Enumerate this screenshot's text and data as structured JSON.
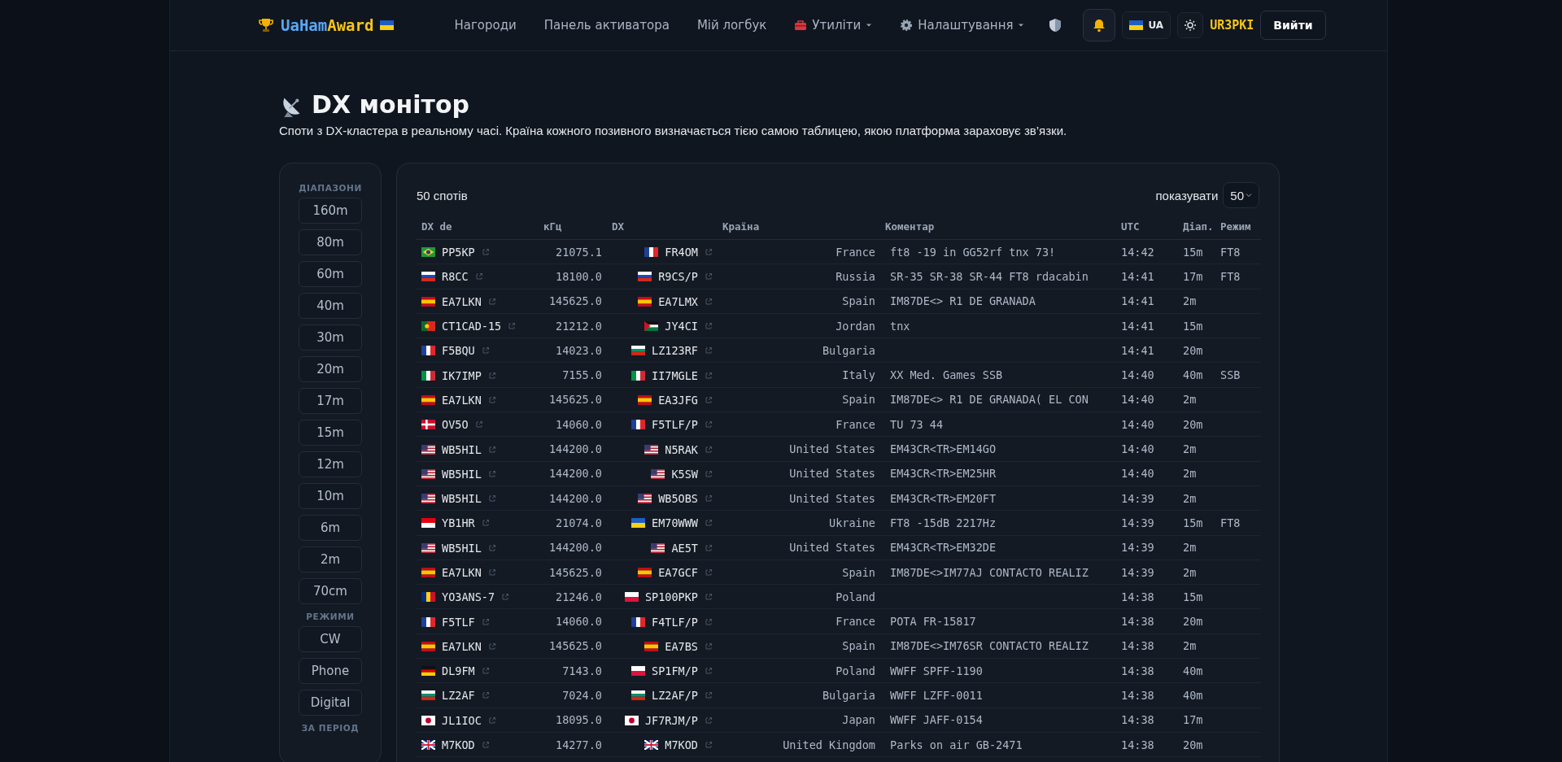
{
  "header": {
    "brand": {
      "first": "UaHam",
      "second": "Award"
    },
    "nav": [
      {
        "label": "Нагороди",
        "kind": "link"
      },
      {
        "label": "Панель активатора",
        "kind": "link"
      },
      {
        "label": "Мій логбук",
        "kind": "link"
      },
      {
        "label": "Утиліти",
        "kind": "tools"
      },
      {
        "label": "Налаштування",
        "kind": "settings"
      }
    ],
    "language": "UA",
    "user": "UR3PKI",
    "logout": "Вийти"
  },
  "page": {
    "title": "DX монітор",
    "subtitle": "Споти з DX-кластера в реальному часі. Країна кожного позивного визначається тією самою таблицею, якою платформа зараховує зв’язки."
  },
  "filters": [
    {
      "heading": "ДІАПАЗОНИ",
      "items": [
        {
          "label": "160m",
          "selected": false
        },
        {
          "label": "80m",
          "selected": false
        },
        {
          "label": "60m",
          "selected": false
        },
        {
          "label": "40m",
          "selected": false
        },
        {
          "label": "30m",
          "selected": false
        },
        {
          "label": "20m",
          "selected": false
        },
        {
          "label": "17m",
          "selected": false
        },
        {
          "label": "15m",
          "selected": false
        },
        {
          "label": "12m",
          "selected": false
        },
        {
          "label": "10m",
          "selected": false
        },
        {
          "label": "6m",
          "selected": false
        },
        {
          "label": "2m",
          "selected": false
        },
        {
          "label": "70cm",
          "selected": false
        }
      ]
    },
    {
      "heading": "РЕЖИМИ",
      "items": [
        {
          "label": "CW",
          "selected": false
        },
        {
          "label": "Phone",
          "selected": false
        },
        {
          "label": "Digital",
          "selected": false
        }
      ]
    },
    {
      "heading": "ЗА ПЕРІОД"
    }
  ],
  "table": {
    "count": "50 спотів",
    "show_label": "показувати",
    "show_value": "50",
    "columns": [
      "DX de",
      "кГц",
      "DX",
      "Країна",
      "Коментар",
      "UTC",
      "Діап.",
      "Режим"
    ],
    "rows": [
      {
        "de": {
          "call": "PP5KP",
          "kind": "br"
        },
        "khz": "21075.1",
        "dx": {
          "call": "FR4OM",
          "kind": "fr"
        },
        "country": "France",
        "comment": "ft8 -19 in GG52rf tnx 73!",
        "utc": "14:42",
        "band": "15m",
        "mode": "FT8"
      },
      {
        "de": {
          "call": "R8CC",
          "kind": "ru"
        },
        "khz": "18100.0",
        "dx": {
          "call": "R9CS/P",
          "kind": "ru"
        },
        "country": "Russia",
        "comment": "SR-35 SR-38 SR-44 FT8 rdacabin",
        "utc": "14:41",
        "band": "17m",
        "mode": "FT8"
      },
      {
        "de": {
          "call": "EA7LKN",
          "kind": "es"
        },
        "khz": "145625.0",
        "dx": {
          "call": "EA7LMX",
          "kind": "es"
        },
        "country": "Spain",
        "comment": "IM87DE<> R1 DE GRANADA",
        "utc": "14:41",
        "band": "2m"
      },
      {
        "de": {
          "call": "CT1CAD-15",
          "kind": "pt"
        },
        "khz": "21212.0",
        "dx": {
          "call": "JY4CI",
          "kind": "jo"
        },
        "country": "Jordan",
        "comment": "tnx",
        "utc": "14:41",
        "band": "15m"
      },
      {
        "de": {
          "call": "F5BQU",
          "kind": "fr"
        },
        "khz": "14023.0",
        "dx": {
          "call": "LZ123RF",
          "kind": "bg"
        },
        "country": "Bulgaria",
        "utc": "14:41",
        "band": "20m"
      },
      {
        "de": {
          "call": "IK7IMP",
          "kind": "it"
        },
        "khz": "7155.0",
        "dx": {
          "call": "II7MGLE",
          "kind": "it"
        },
        "country": "Italy",
        "comment": "XX Med. Games SSB",
        "utc": "14:40",
        "band": "40m",
        "mode": "SSB"
      },
      {
        "de": {
          "call": "EA7LKN",
          "kind": "es"
        },
        "khz": "145625.0",
        "dx": {
          "call": "EA3JFG",
          "kind": "es"
        },
        "country": "Spain",
        "comment": "IM87DE<> R1 DE GRANADA( EL CON",
        "utc": "14:40",
        "band": "2m"
      },
      {
        "de": {
          "call": "OV5O",
          "kind": "dk"
        },
        "khz": "14060.0",
        "dx": {
          "call": "F5TLF/P",
          "kind": "fr"
        },
        "country": "France",
        "comment": "TU 73 44",
        "utc": "14:40",
        "band": "20m"
      },
      {
        "de": {
          "call": "WB5HIL",
          "kind": "us"
        },
        "khz": "144200.0",
        "dx": {
          "call": "N5RAK",
          "kind": "us"
        },
        "country": "United States",
        "comment": "EM43CR<TR>EM14GO",
        "utc": "14:40",
        "band": "2m"
      },
      {
        "de": {
          "call": "WB5HIL",
          "kind": "us"
        },
        "khz": "144200.0",
        "dx": {
          "call": "K5SW",
          "kind": "us"
        },
        "country": "United States",
        "comment": "EM43CR<TR>EM25HR",
        "utc": "14:40",
        "band": "2m"
      },
      {
        "de": {
          "call": "WB5HIL",
          "kind": "us"
        },
        "khz": "144200.0",
        "dx": {
          "call": "WB5OBS",
          "kind": "us"
        },
        "country": "United States",
        "comment": "EM43CR<TR>EM20FT",
        "utc": "14:39",
        "band": "2m"
      },
      {
        "de": {
          "call": "YB1HR",
          "kind": "id"
        },
        "khz": "21074.0",
        "dx": {
          "call": "EM70WWW",
          "kind": "ua"
        },
        "country": "Ukraine",
        "comment": "FT8 -15dB 2217Hz",
        "utc": "14:39",
        "band": "15m",
        "mode": "FT8"
      },
      {
        "de": {
          "call": "WB5HIL",
          "kind": "us"
        },
        "khz": "144200.0",
        "dx": {
          "call": "AE5T",
          "kind": "us"
        },
        "country": "United States",
        "comment": "EM43CR<TR>EM32DE",
        "utc": "14:39",
        "band": "2m"
      },
      {
        "de": {
          "call": "EA7LKN",
          "kind": "es"
        },
        "khz": "145625.0",
        "dx": {
          "call": "EA7GCF",
          "kind": "es"
        },
        "country": "Spain",
        "comment": "IM87DE<>IM77AJ CONTACTO REALIZ",
        "utc": "14:39",
        "band": "2m"
      },
      {
        "de": {
          "call": "YO3ANS-7",
          "kind": "ro"
        },
        "khz": "21246.0",
        "dx": {
          "call": "SP100PKP",
          "kind": "pl"
        },
        "country": "Poland",
        "utc": "14:38",
        "band": "15m"
      },
      {
        "de": {
          "call": "F5TLF",
          "kind": "fr"
        },
        "khz": "14060.0",
        "dx": {
          "call": "F4TLF/P",
          "kind": "fr"
        },
        "country": "France",
        "comment": "POTA FR-15817",
        "utc": "14:38",
        "band": "20m"
      },
      {
        "de": {
          "call": "EA7LKN",
          "kind": "es"
        },
        "khz": "145625.0",
        "dx": {
          "call": "EA7BS",
          "kind": "es"
        },
        "country": "Spain",
        "comment": "IM87DE<>IM76SR CONTACTO REALIZ",
        "utc": "14:38",
        "band": "2m"
      },
      {
        "de": {
          "call": "DL9FM",
          "kind": "de"
        },
        "khz": "7143.0",
        "dx": {
          "call": "SP1FM/P",
          "kind": "pl"
        },
        "country": "Poland",
        "comment": "WWFF SPFF-1190",
        "utc": "14:38",
        "band": "40m"
      },
      {
        "de": {
          "call": "LZ2AF",
          "kind": "bg"
        },
        "khz": "7024.0",
        "dx": {
          "call": "LZ2AF/P",
          "kind": "bg"
        },
        "country": "Bulgaria",
        "comment": "WWFF LZFF-0011",
        "utc": "14:38",
        "band": "40m"
      },
      {
        "de": {
          "call": "JL1IOC",
          "kind": "jp"
        },
        "khz": "18095.0",
        "dx": {
          "call": "JF7RJM/P",
          "kind": "jp"
        },
        "country": "Japan",
        "comment": "WWFF JAFF-0154",
        "utc": "14:38",
        "band": "17m"
      },
      {
        "de": {
          "call": "M7KOD",
          "kind": "gb"
        },
        "khz": "14277.0",
        "dx": {
          "call": "M7KOD",
          "kind": "gb"
        },
        "country": "United Kingdom",
        "comment": "Parks on air GB-2471",
        "utc": "14:38",
        "band": "20m"
      }
    ]
  }
}
